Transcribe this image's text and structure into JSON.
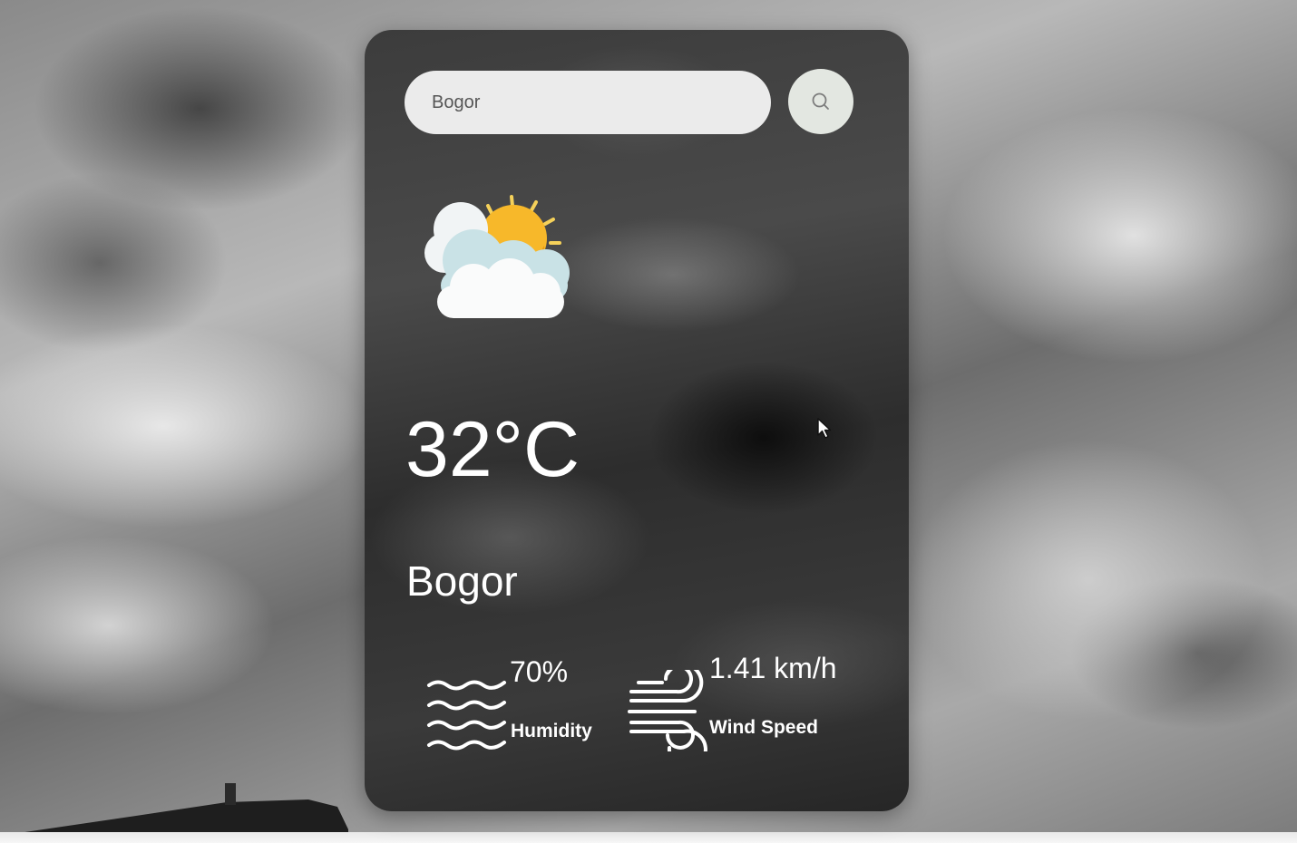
{
  "search": {
    "value": "Bogor",
    "button_icon": "search-icon"
  },
  "weather": {
    "icon": "partly-cloudy-sun-icon",
    "temperature": "32°C",
    "city": "Bogor"
  },
  "humidity": {
    "icon": "humidity-waves-icon",
    "value": "70%",
    "label": "Humidity"
  },
  "wind": {
    "icon": "wind-icon",
    "value": "1.41 km/h",
    "label": "Wind Speed"
  },
  "colors": {
    "card_background": "#3a3a3a",
    "search_field": "#ebebeb",
    "search_button": "#e3e7e1",
    "sun": "#f7b82a",
    "text": "#ffffff"
  }
}
